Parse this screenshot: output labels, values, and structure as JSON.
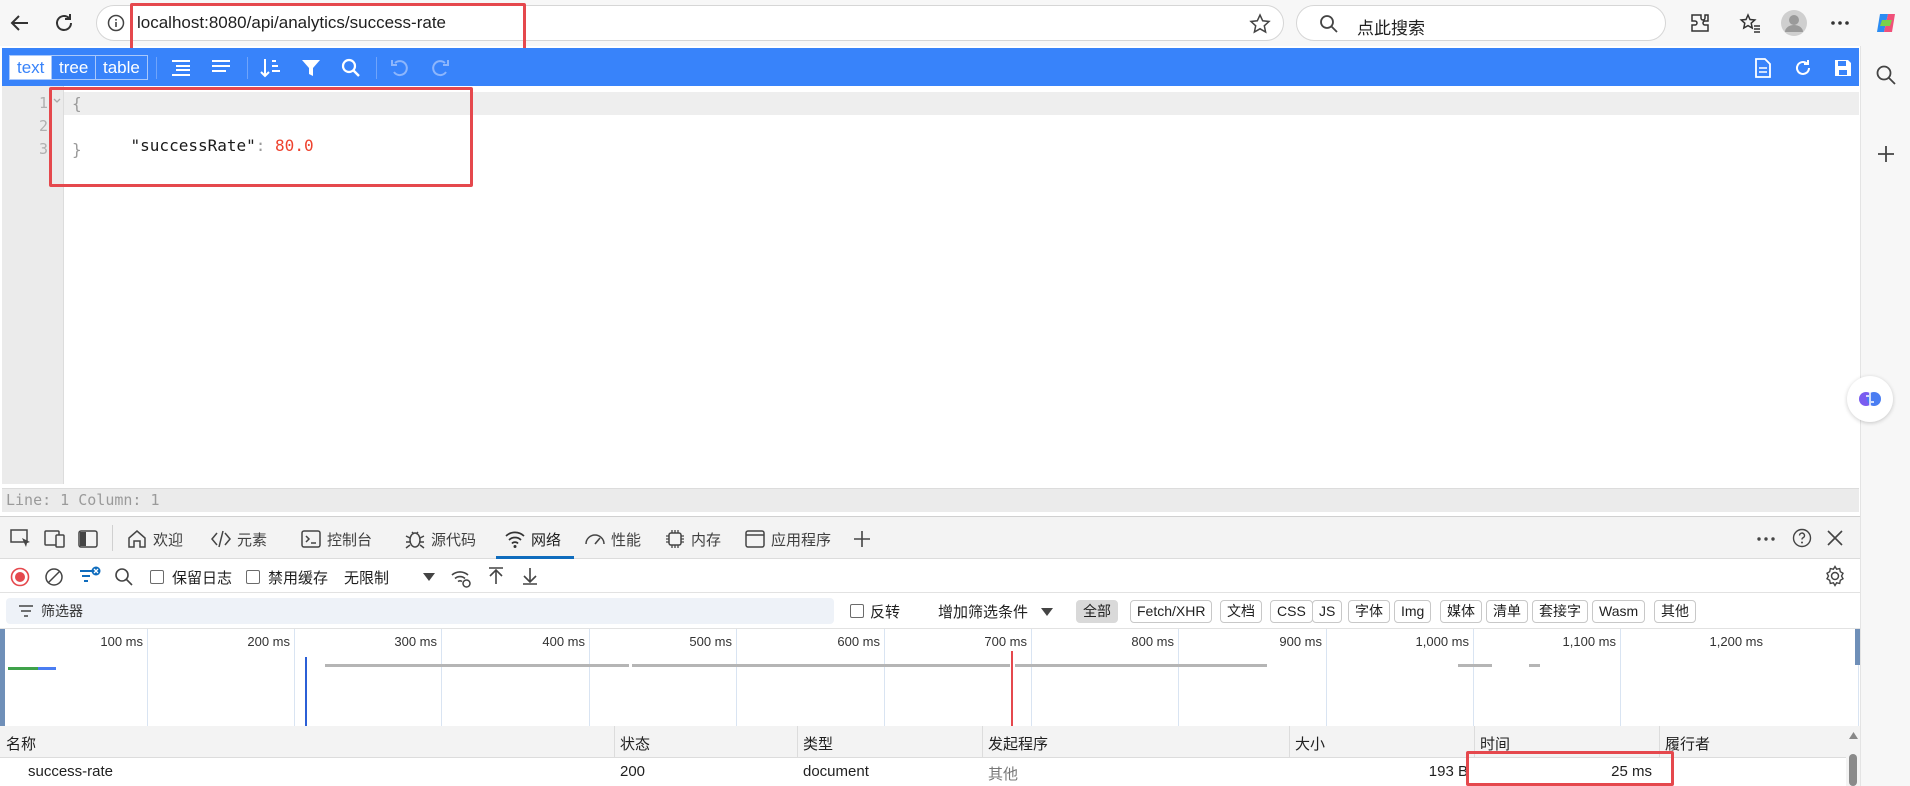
{
  "browser": {
    "url": "localhost:8080/api/analytics/success-rate",
    "search_placeholder": "点此搜索"
  },
  "json_viewer": {
    "modes": [
      "text",
      "tree",
      "table"
    ],
    "active_mode": "text",
    "lines": [
      {
        "no": "1",
        "text": "{"
      },
      {
        "no": "2",
        "key": "\"successRate\"",
        "colon": ":",
        "value": "80.0"
      },
      {
        "no": "3",
        "text": "}"
      }
    ],
    "status": "Line: 1  Column: 1"
  },
  "devtools": {
    "tabs": [
      {
        "label": "欢迎",
        "icon": "home-icon"
      },
      {
        "label": "元素",
        "icon": "code-icon"
      },
      {
        "label": "控制台",
        "icon": "console-icon"
      },
      {
        "label": "源代码",
        "icon": "bug-icon"
      },
      {
        "label": "网络",
        "icon": "wifi-icon"
      },
      {
        "label": "性能",
        "icon": "gauge-icon"
      },
      {
        "label": "内存",
        "icon": "chip-icon"
      },
      {
        "label": "应用程序",
        "icon": "app-window-icon"
      }
    ],
    "active_tab": "网络",
    "toolbar": {
      "preserve_log": "保留日志",
      "disable_cache": "禁用缓存",
      "throttling": "无限制"
    },
    "filter": {
      "placeholder": "筛选器",
      "invert": "反转",
      "more_filters": "增加筛选条件",
      "types": [
        "全部",
        "Fetch/XHR",
        "文档",
        "CSS",
        "JS",
        "字体",
        "Img",
        "媒体",
        "清单",
        "套接字",
        "Wasm",
        "其他"
      ],
      "active_type": "全部"
    },
    "timeline_ticks": [
      "100 ms",
      "200 ms",
      "300 ms",
      "400 ms",
      "500 ms",
      "600 ms",
      "700 ms",
      "800 ms",
      "900 ms",
      "1,000 ms",
      "1,100 ms",
      "1,200 ms"
    ],
    "columns": [
      "名称",
      "状态",
      "类型",
      "发起程序",
      "大小",
      "时间",
      "履行者"
    ],
    "rows": [
      {
        "name": "success-rate",
        "status": "200",
        "type": "document",
        "initiator": "其他",
        "size": "193 B",
        "time": "25 ms",
        "fulfilled_by": ""
      }
    ]
  },
  "colors": {
    "json_toolbar": "#3883fa",
    "json_number": "#ee422e",
    "highlight_box": "#e5484d",
    "network_tab_underline": "#0f6cbd"
  }
}
